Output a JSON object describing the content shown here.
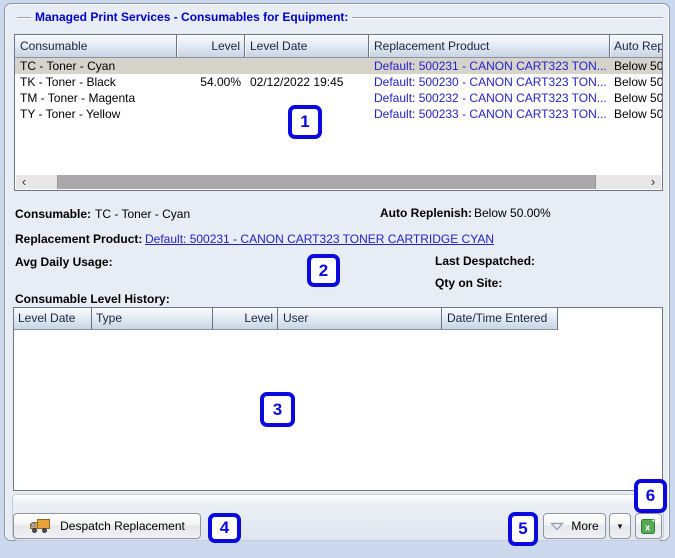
{
  "title": "Managed Print Services - Consumables for Equipment:",
  "consumables_table": {
    "columns": [
      "Consumable",
      "Level",
      "Level Date",
      "Replacement Product",
      "Auto Rep"
    ],
    "rows": [
      {
        "consumable": "TC - Toner - Cyan",
        "level": "",
        "level_date": "",
        "replacement_product": "Default: 500231 - CANON CART323 TON...",
        "auto_replenish": "Below 50."
      },
      {
        "consumable": "TK - Toner - Black",
        "level": "54.00%",
        "level_date": "02/12/2022 19:45",
        "replacement_product": "Default: 500230 - CANON CART323 TON...",
        "auto_replenish": "Below 50."
      },
      {
        "consumable": "TM - Toner - Magenta",
        "level": "",
        "level_date": "",
        "replacement_product": "Default: 500232 - CANON CART323 TON...",
        "auto_replenish": "Below 50."
      },
      {
        "consumable": "TY - Toner - Yellow",
        "level": "",
        "level_date": "",
        "replacement_product": "Default: 500233 - CANON CART323 TON...",
        "auto_replenish": "Below 50."
      }
    ]
  },
  "details": {
    "consumable_label": "Consumable:",
    "consumable_value": "TC - Toner - Cyan",
    "auto_replenish_label": "Auto Replenish:",
    "auto_replenish_value": "Below 50.00%",
    "replacement_label": "Replacement Product:",
    "replacement_link": "Default: 500231 - CANON CART323 TONER CARTRIDGE CYAN",
    "avg_daily_usage_label": "Avg Daily Usage:",
    "last_despatched_label": "Last Despatched:",
    "qty_on_site_label": "Qty on Site:"
  },
  "history": {
    "label": "Consumable Level History:",
    "columns": [
      "Level Date",
      "Type",
      "Level",
      "User",
      "Date/Time Entered"
    ]
  },
  "toolbar": {
    "despatch_label": "Despatch Replacement",
    "more_label": "More"
  },
  "icons": {
    "scroll_left": "‹",
    "scroll_right": "›",
    "dropdown_caret": "▼"
  },
  "callouts": [
    "1",
    "2",
    "3",
    "4",
    "5",
    "6"
  ],
  "colors": {
    "title_blue": "#0000cc",
    "link_blue": "#2121cc",
    "callout_blue": "#0a0ae0",
    "selected_row_gray": "#d6d3cb",
    "excel_green": "#57a957",
    "truck_orange": "#e8a33d",
    "panel_background": "#e7ecf5",
    "outer_background": "#ccd8ee"
  }
}
